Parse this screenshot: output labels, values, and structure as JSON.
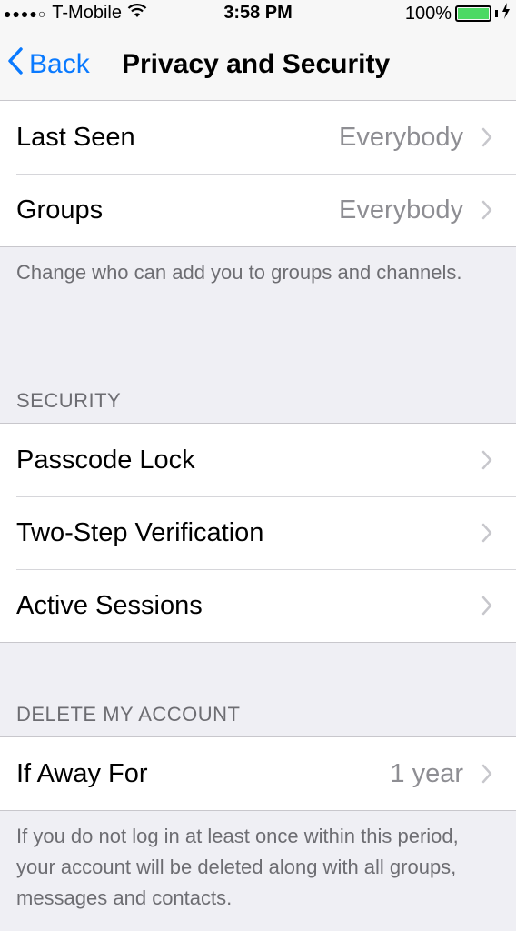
{
  "status_bar": {
    "carrier": "T-Mobile",
    "time": "3:58 PM",
    "battery": "100%"
  },
  "nav": {
    "back_label": "Back",
    "title": "Privacy and Security"
  },
  "privacy_rows": [
    {
      "label": "Last Seen",
      "value": "Everybody"
    },
    {
      "label": "Groups",
      "value": "Everybody"
    }
  ],
  "groups_footer": "Change who can add you to groups and channels.",
  "security": {
    "header": "SECURITY",
    "rows": [
      {
        "label": "Passcode Lock"
      },
      {
        "label": "Two-Step Verification"
      },
      {
        "label": "Active Sessions"
      }
    ]
  },
  "delete_account": {
    "header": "DELETE MY ACCOUNT",
    "row": {
      "label": "If Away For",
      "value": "1 year"
    },
    "footer": "If you do not log in at least once within this period, your account will be deleted along with all groups, messages and contacts."
  },
  "colors": {
    "accent": "#0a7aff",
    "background": "#efeff4",
    "secondary_text": "#8e8e93",
    "battery": "#4cd964"
  }
}
